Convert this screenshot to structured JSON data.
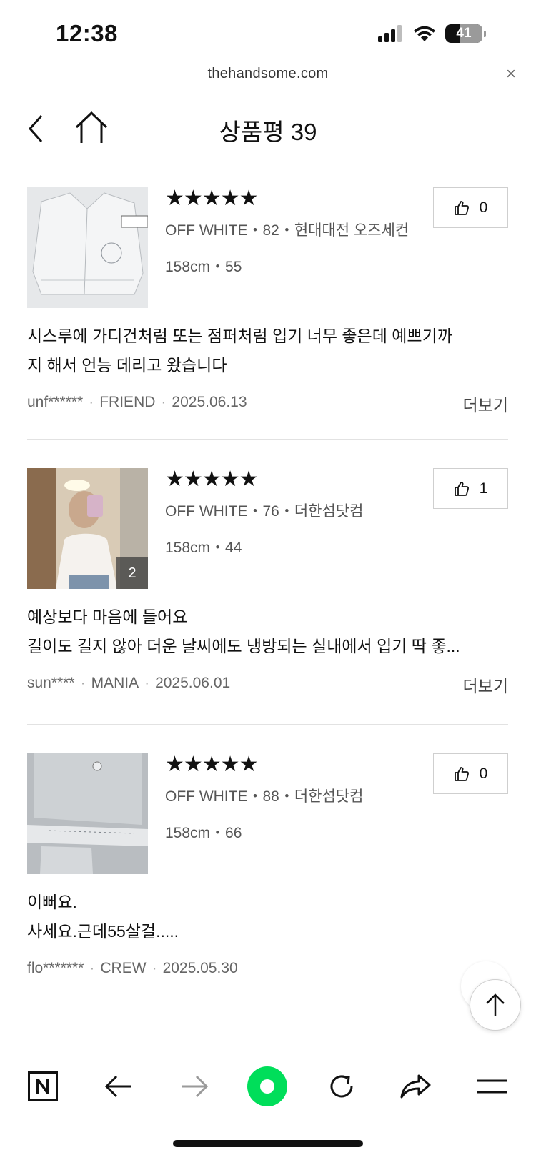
{
  "status_bar": {
    "time": "12:38",
    "battery": "41",
    "battery_level": 0.41
  },
  "browser": {
    "url": "thehandsome.com",
    "close_symbol": "×"
  },
  "header": {
    "title": "상품평 39"
  },
  "reviews": [
    {
      "stars": "★★★★★",
      "rating": 5,
      "product": "OFF WHITE・82・현대대전 오즈세컨",
      "size": "158cm・55",
      "likes": "0",
      "body": [
        "시스루에 가디건처럼 또는 점퍼처럼 입기 너무 좋은데 예쁘기까",
        "지 해서 언능 데리고 왔습니다"
      ],
      "user": "unf******",
      "grade": "FRIEND",
      "date": "2025.06.13",
      "more": "더보기",
      "photo_count": ""
    },
    {
      "stars": "★★★★★",
      "rating": 5,
      "product": "OFF WHITE・76・더한섬닷컴",
      "size": "158cm・44",
      "likes": "1",
      "body": [
        "예상보다 마음에 들어요",
        "길이도 길지 않아 더운 날씨에도 냉방되는 실내에서 입기 딱 좋..."
      ],
      "user": "sun****",
      "grade": "MANIA",
      "date": "2025.06.01",
      "more": "더보기",
      "photo_count": "2"
    },
    {
      "stars": "★★★★★",
      "rating": 5,
      "product": "OFF WHITE・88・더한섬닷컴",
      "size": "158cm・66",
      "likes": "0",
      "body": [
        "이뻐요.",
        "사세요.근데55살걸....."
      ],
      "user": "flo*******",
      "grade": "CREW",
      "date": "2025.05.30",
      "more": "",
      "photo_count": ""
    }
  ],
  "toolbar": {
    "items": [
      "naver-icon",
      "back-arrow-icon",
      "forward-arrow-icon",
      "green-dot-icon",
      "refresh-icon",
      "share-icon",
      "menu-icon"
    ],
    "accent": "#00de5a"
  }
}
